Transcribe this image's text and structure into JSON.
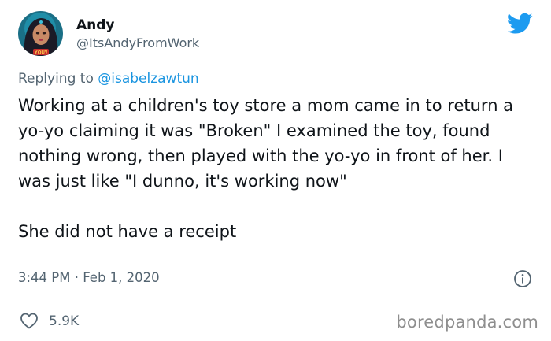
{
  "author": {
    "name": "Andy",
    "handle": "@ItsAndyFromWork",
    "avatar_badge": "YOU'!"
  },
  "reply": {
    "prefix": "Replying to ",
    "mention": "@isabelzawtun"
  },
  "tweet": {
    "text": "Working at a children's toy store a mom came in to return a yo-yo claiming it was \"Broken\" I examined the toy, found nothing wrong, then played with the yo-yo in front of her. I was just like \"I dunno, it's working now\"\n\nShe did not have a receipt",
    "timestamp": "3:44 PM · Feb 1, 2020"
  },
  "actions": {
    "likes": "5.9K"
  },
  "watermark": "boredpanda.com",
  "icons": {
    "brand": "twitter-bird-icon",
    "info": "info-icon",
    "like": "heart-icon"
  },
  "colors": {
    "twitter_blue": "#1d9bf0",
    "mention_blue": "#1b95e0",
    "secondary_text": "#536471"
  }
}
